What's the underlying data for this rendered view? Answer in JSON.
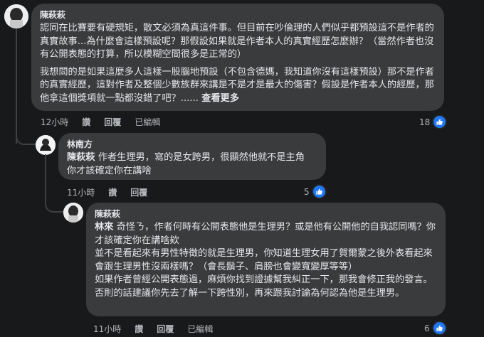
{
  "comments": [
    {
      "author": "陳萩萩",
      "paragraphs": [
        "認同在比賽要有硬規矩，散文必須為真這件事。但目前在吵倫理的人們似乎都預設這不是作者的真實故事...為什麼會這樣預設呢？那假設如果就是作者本人的真實經歷怎麼辦？（當然作者也沒有公開表態的打算，所以模糊空間很多是正常的）",
        "我想問的是如果這麼多人這樣一股腦地預設（不包含德媽，我知道你沒有這樣預設）那不是作者的真實經歷，這對作者及整個少數族群來講是不是才是最大的傷害？假設是作者本人的經歷，那他拿這個獎項就一點都沒錯了吧？......"
      ],
      "see_more": "查看更多",
      "time": "12小時",
      "like": "讚",
      "reply": "回覆",
      "edited": "已編輯",
      "reaction_count": "18"
    },
    {
      "author": "林南方",
      "mention": "陳萩萩",
      "paragraphs": [
        " 作者生理男，寫的是女跨男，很顯然他就不是主角\n你才該確定你在講啥"
      ],
      "time": "11小時",
      "like": "讚",
      "reply": "回覆",
      "reaction_count": "5"
    },
    {
      "author": "陳萩萩",
      "mention": "林來",
      "paragraphs": [
        " 奇怪ㄋ，作者何時有公開表態他是生理男？或是他有公開他的自我認同嗎？你才該確定你在講啥欸\n並不是看起來有男性特徵的就是生理男，你知道生理女用了賀爾蒙之後外表看起來會跟生理男性沒兩樣嗎？（會長鬍子、肩膀也會變寬變厚等等）\n如果作者曾經公開表態過，麻煩你找到證據幫我糾正一下，那我會修正我的發言。否則的話建議你先去了解一下跨性別，再來跟我討論為何認為他是生理男。"
      ],
      "time": "11小時",
      "like": "讚",
      "reply": "回覆",
      "edited": "已編輯",
      "reaction_count": "6"
    }
  ],
  "colors": {
    "background": "#18191a",
    "bubble": "#3a3b3c",
    "text": "#e4e6eb",
    "meta": "#b0b3b8",
    "like_badge": "#2078f4"
  },
  "icons": {
    "like": "thumbs-up-icon"
  }
}
